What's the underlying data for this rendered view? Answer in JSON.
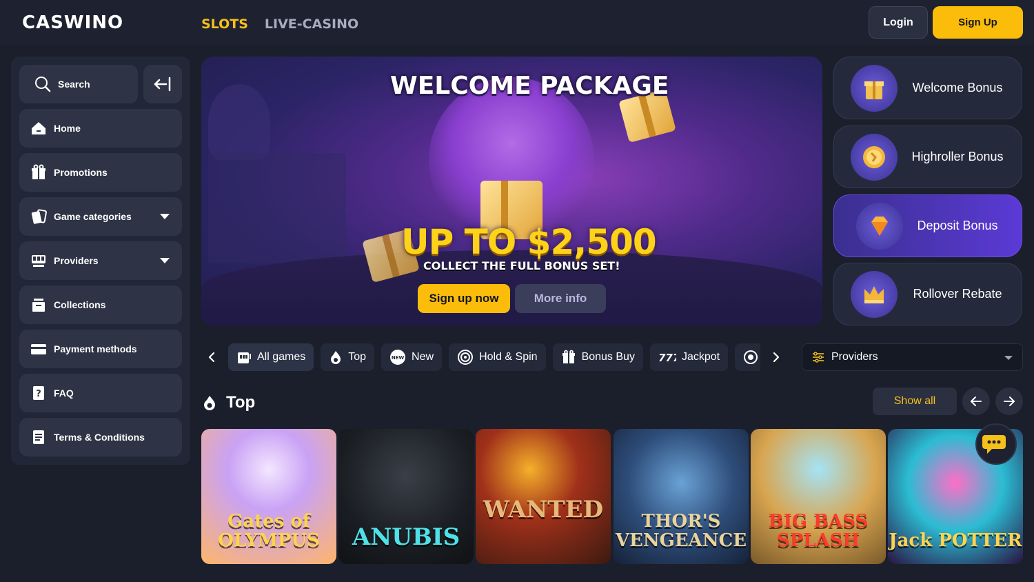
{
  "header": {
    "logo": "CASWINO",
    "nav": [
      {
        "label": "SLOTS"
      },
      {
        "label": "LIVE-CASINO"
      }
    ],
    "login_label": "Login",
    "signup_label": "Sign Up"
  },
  "sidebar": {
    "search_label": "Search",
    "items": [
      {
        "label": "Home",
        "icon": "home-icon"
      },
      {
        "label": "Promotions",
        "icon": "gift-icon"
      },
      {
        "label": "Game categories",
        "icon": "cards-icon"
      },
      {
        "label": "Providers",
        "icon": "slot-machine-icon"
      },
      {
        "label": "Collections",
        "icon": "archive-icon"
      },
      {
        "label": "Payment methods",
        "icon": "credit-card-icon"
      },
      {
        "label": "FAQ",
        "icon": "question-icon"
      },
      {
        "label": "Terms & Conditions",
        "icon": "document-icon"
      }
    ]
  },
  "banner": {
    "title": "WELCOME PACKAGE",
    "amount": "UP TO $2,500",
    "subtitle": "COLLECT THE FULL BONUS SET!",
    "primary_label": "Sign up now",
    "secondary_label": "More info"
  },
  "bonuses": [
    {
      "label": "Welcome Bonus",
      "icon": "gift-box-icon",
      "active": false
    },
    {
      "label": "Highroller Bonus",
      "icon": "coin-icon",
      "active": false
    },
    {
      "label": "Deposit Bonus",
      "icon": "diamond-icon",
      "active": true
    },
    {
      "label": "Rollover Rebate",
      "icon": "crown-icon",
      "active": false
    }
  ],
  "tabs": [
    {
      "label": "All games",
      "icon": "slot-icon"
    },
    {
      "label": "Top",
      "icon": "flame-icon"
    },
    {
      "label": "New",
      "icon": "new-badge-icon"
    },
    {
      "label": "Hold & Spin",
      "icon": "spin-icon"
    },
    {
      "label": "Bonus Buy",
      "icon": "gift-icon"
    },
    {
      "label": "Jackpot",
      "icon": "sevens-icon"
    }
  ],
  "providers_label": "Providers",
  "section": {
    "title": "Top",
    "show_all_label": "Show all"
  },
  "games": [
    {
      "name": "Gates of OLYMPUS"
    },
    {
      "name": "ANUBIS"
    },
    {
      "name": "WANTED"
    },
    {
      "name": "THOR'S VENGEANCE"
    },
    {
      "name": "BIG BASS SPLASH"
    },
    {
      "name": "Jack POTTER"
    }
  ],
  "colors": {
    "accent": "#fbbd09",
    "background": "#1b1f2c",
    "panel": "#222738",
    "active_bonus": "#5b3ad6"
  }
}
